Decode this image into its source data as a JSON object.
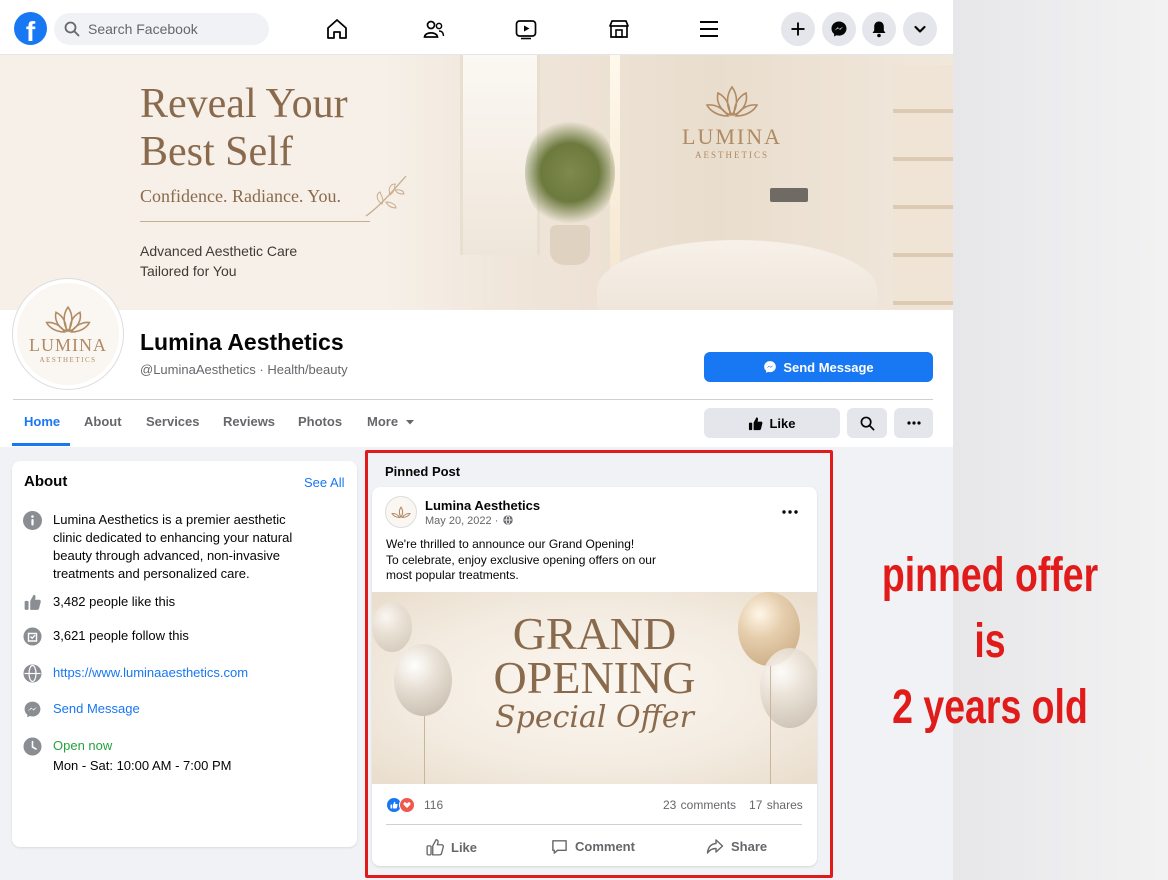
{
  "topbar": {
    "logo_letter": "f",
    "search_placeholder": "Search Facebook",
    "nav_icons": [
      "home-icon",
      "friends-icon",
      "watch-icon",
      "marketplace-icon",
      "menu-icon"
    ],
    "action_icons": [
      "plus-icon",
      "messenger-icon",
      "bell-icon",
      "chevron-down-icon"
    ]
  },
  "cover": {
    "headline_line1": "Reveal Your",
    "headline_line2": "Best Self",
    "tagline": "Confidence. Radiance. You.",
    "sub_line1": "Advanced Aesthetic Care",
    "sub_line2": "Tailored for You",
    "wall_logo_name": "LUMINA",
    "wall_logo_sub": "AESTHETICS"
  },
  "profile": {
    "avatar_name": "LUMINA",
    "avatar_sub": "AESTHETICS",
    "name": "Lumina Aesthetics",
    "handle": "@LuminaAesthetics · Health/beauty",
    "send_message": "Send Message",
    "like_button": "Like"
  },
  "tabs": [
    {
      "label": "Home",
      "active": true
    },
    {
      "label": "About"
    },
    {
      "label": "Services"
    },
    {
      "label": "Reviews"
    },
    {
      "label": "Photos"
    },
    {
      "label": "More"
    }
  ],
  "about": {
    "title": "About",
    "see_all": "See All",
    "description": "Lumina Aesthetics is a premier aesthetic clinic dedicated to enhancing your natural beauty through advanced, non-invasive treatments and personalized care.",
    "likes": "3,482 people like this",
    "follows": "3,621 people follow this",
    "website": "https://www.luminaaesthetics.com",
    "send_message": "Send Message",
    "status": "Open now",
    "hours": "Mon - Sat: 10:00 AM - 7:00 PM"
  },
  "pinned_post": {
    "label": "Pinned Post",
    "author": "Lumina Aesthetics",
    "date": "May 20, 2022 ·",
    "text_line1": "We're thrilled to announce our Grand Opening!",
    "text_line2": "To celebrate, enjoy exclusive opening offers on our",
    "text_line3": "most popular treatments.",
    "image_line1": "GRAND",
    "image_line2": "OPENING",
    "image_script": "Special Offer",
    "reactions": "116",
    "comments": "23 comments",
    "shares": "17 shares",
    "actions": {
      "like": "Like",
      "comment": "Comment",
      "share": "Share"
    }
  },
  "annotation": {
    "line1": "pinned offer is",
    "line2": "2 years old",
    "color": "#e11a1a"
  },
  "colors": {
    "brand": "#1877f2",
    "accent_text": "#8a6a4d",
    "annotation": "#e11a1a"
  }
}
